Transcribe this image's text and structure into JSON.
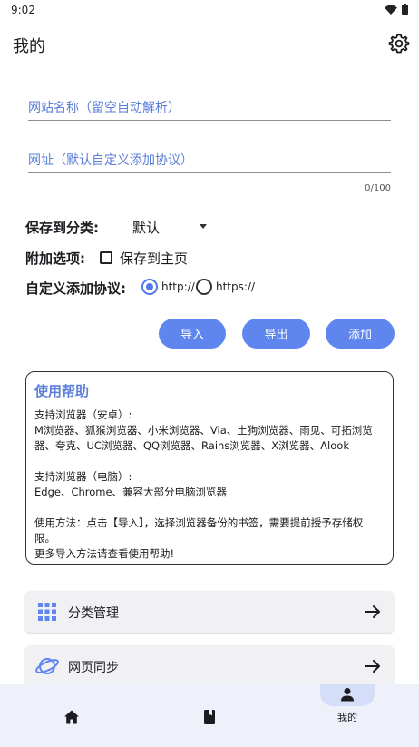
{
  "status_bar": {
    "time": "9:02"
  },
  "header": {
    "title": "我的",
    "settings_icon": "gear-icon"
  },
  "form": {
    "site_name_placeholder": "网站名称（留空自动解析）",
    "url_placeholder": "网址（默认自定义添加协议）",
    "char_counter": "0/100",
    "category_label": "保存到分类:",
    "category_value": "默认",
    "extra_options_label": "附加选项:",
    "save_to_home_label": "保存到主页",
    "save_to_home_checked": false,
    "protocol_label": "自定义添加协议:",
    "protocols": [
      "http://",
      "https://"
    ],
    "selected_protocol": "http://"
  },
  "actions": {
    "import_label": "导入",
    "export_label": "导出",
    "add_label": "添加"
  },
  "help": {
    "title": "使用帮助",
    "android_heading": "支持浏览器（安卓）:",
    "android_list": "M浏览器、狐猴浏览器、小米浏览器、Via、土狗浏览器、雨见、可拓浏览器、夸克、UC浏览器、QQ浏览器、Rains浏览器、X浏览器、Alook",
    "pc_heading": "支持浏览器（电脑）:",
    "pc_list": "Edge、Chrome、兼容大部分电脑浏览器",
    "usage": "使用方法：点击【导入】，选择浏览器备份的书签，需要提前授予存储权限。",
    "more": "更多导入方法请查看使用帮助!"
  },
  "menu": [
    {
      "label": "分类管理",
      "icon": "grid-icon"
    },
    {
      "label": "网页同步",
      "icon": "planet-icon"
    }
  ],
  "bottom_nav": {
    "items": [
      {
        "icon": "home-icon",
        "label": ""
      },
      {
        "icon": "bookmark-icon",
        "label": ""
      },
      {
        "icon": "person-icon",
        "label": "我的"
      }
    ],
    "active_index": 2
  },
  "colors": {
    "accent": "#5f86ee",
    "placeholder": "#5b7fd9",
    "nav_background": "#eef0fa",
    "nav_active_pill": "#d5def8",
    "card_background": "#f1f1f4"
  }
}
